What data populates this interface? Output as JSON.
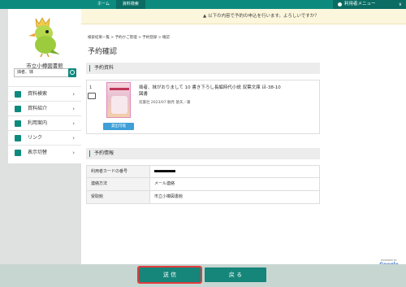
{
  "topnav": {
    "home": "ホーム",
    "search": "資料検索"
  },
  "user_menu": {
    "label": "利用者メニュー",
    "chevron": "∨"
  },
  "notice": {
    "text": "以下の内容で予約の申込を行います。よろしいですか？"
  },
  "sidebar": {
    "library_name": "市立小樽図書館",
    "search_value": "拙者、妹",
    "items": [
      {
        "label": "資料検索",
        "icon": "book-search-icon"
      },
      {
        "label": "資料紹介",
        "icon": "book-intro-icon"
      },
      {
        "label": "利用案内",
        "icon": "person-icon"
      },
      {
        "label": "リンク",
        "icon": "link-icon"
      },
      {
        "label": "表示切替",
        "icon": "switch-icon"
      }
    ]
  },
  "breadcrumb": {
    "a": "検索結果一覧",
    "b": "予約かご管理",
    "c": "予約登録",
    "d": "確認",
    "sep": " > "
  },
  "page_title": "予約確認",
  "reservation": {
    "section_title": "予約資料",
    "number": "1",
    "book_title": "拙者、妹がおりまして 10 書き下ろし長編時代小説 双葉文庫 ほ-38-10",
    "book_title2": "図書",
    "meta": "双葉社 2023/07   馳月 基矢／著",
    "status": "貸出可能"
  },
  "info": {
    "section_title": "予約情報",
    "rows": [
      {
        "label": "利用者カードの番号",
        "value": ""
      },
      {
        "label": "連絡方法",
        "value": "メール連絡"
      },
      {
        "label": "受取館",
        "value": "市立小樽図書館"
      }
    ]
  },
  "powered": {
    "by": "POWERED BY",
    "brand": "Google"
  },
  "buttons": {
    "send": "送 信",
    "back": "戻 る"
  },
  "colors": {
    "accent": "#0d8a7e",
    "notice_bg": "#fbf6dc",
    "status": "#3f9fd7",
    "highlight": "#e23b3b"
  }
}
